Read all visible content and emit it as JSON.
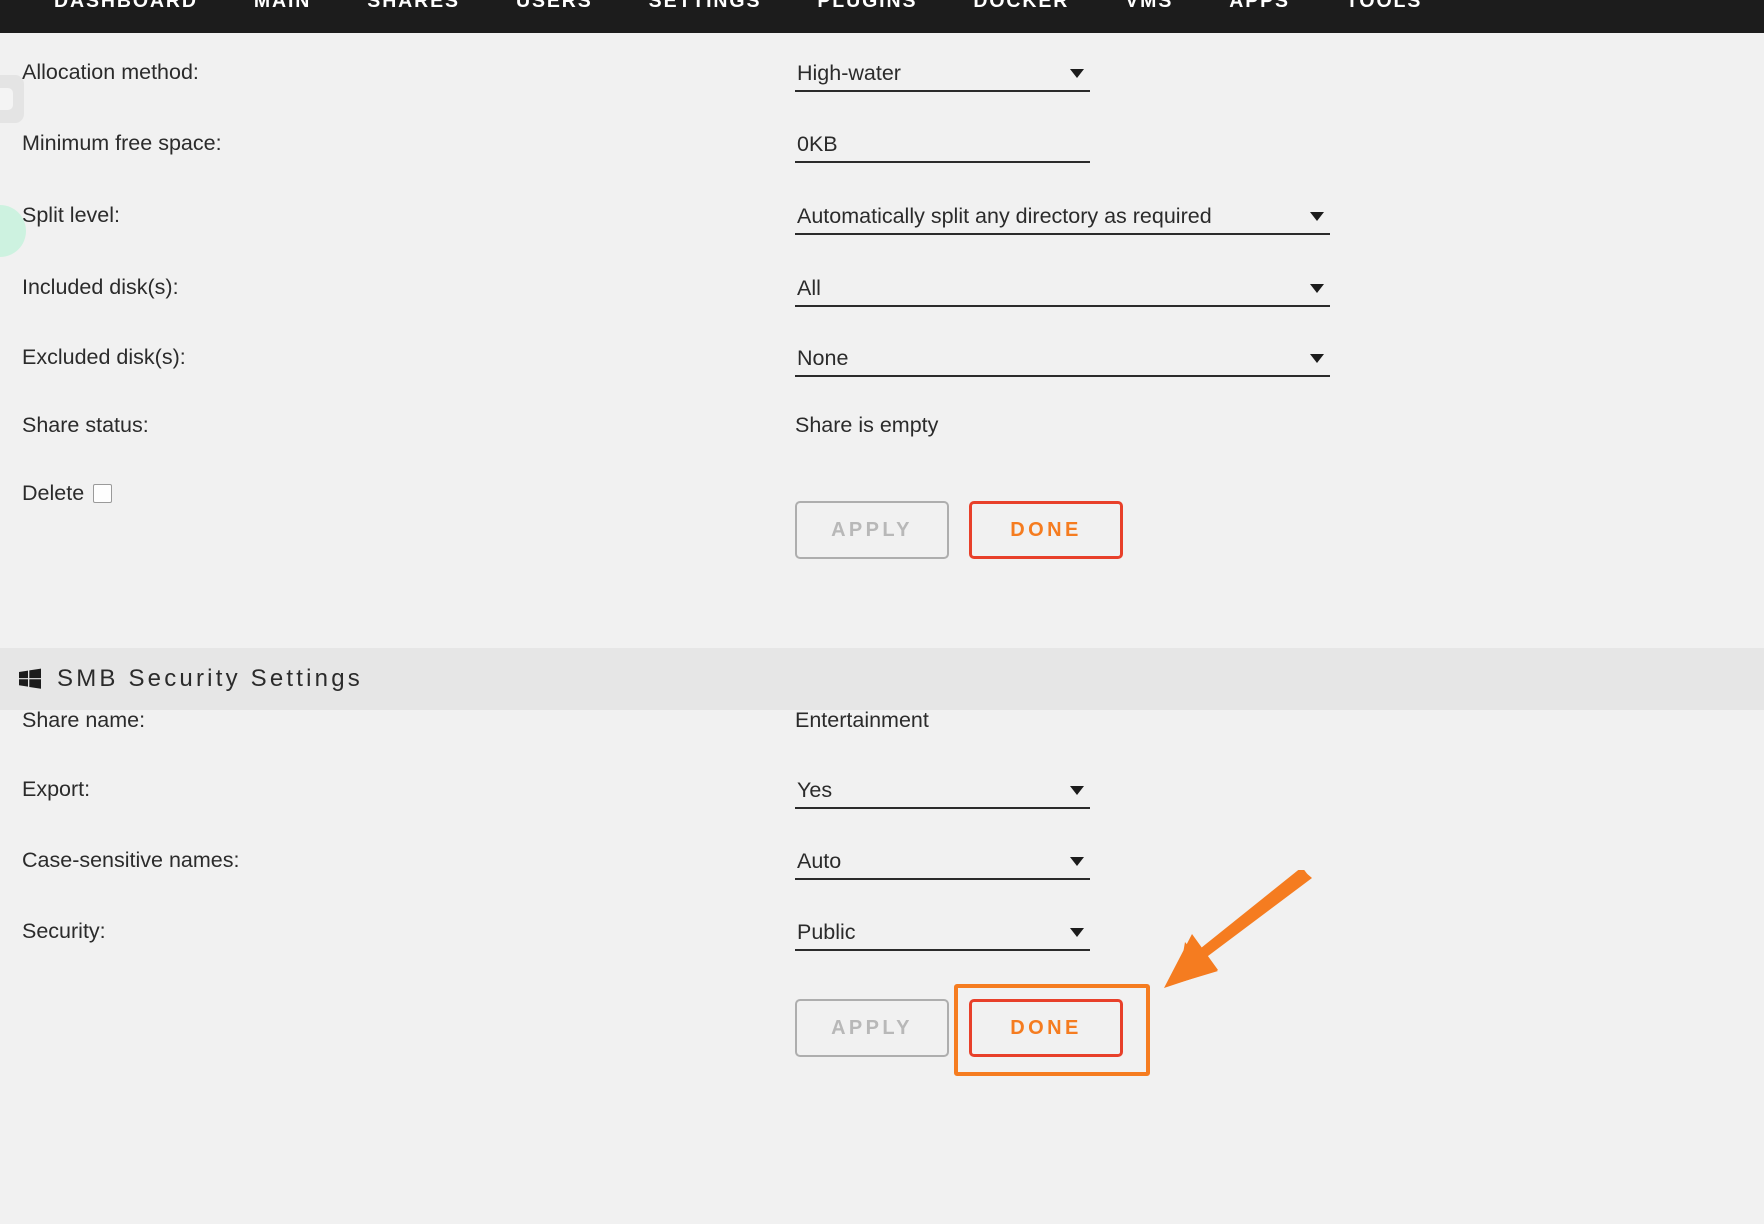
{
  "nav": {
    "items": [
      {
        "label": "DASHBOARD",
        "active": false
      },
      {
        "label": "MAIN",
        "active": false
      },
      {
        "label": "SHARES",
        "active": true
      },
      {
        "label": "USERS",
        "active": false
      },
      {
        "label": "SETTINGS",
        "active": false
      },
      {
        "label": "PLUGINS",
        "active": false
      },
      {
        "label": "DOCKER",
        "active": false
      },
      {
        "label": "VMS",
        "active": false
      },
      {
        "label": "APPS",
        "active": false
      },
      {
        "label": "TOOLS",
        "active": false
      }
    ]
  },
  "share_settings": {
    "allocation_method": {
      "label": "Allocation method:",
      "value": "High-water"
    },
    "minimum_free_space": {
      "label": "Minimum free space:",
      "value": "0KB",
      "placeholder": "0KB"
    },
    "split_level": {
      "label": "Split level:",
      "value": "Automatically split any directory as required"
    },
    "included_disks": {
      "label": "Included disk(s):",
      "value": "All"
    },
    "excluded_disks": {
      "label": "Excluded disk(s):",
      "value": "None"
    },
    "share_status": {
      "label": "Share status:",
      "value": "Share is empty"
    },
    "delete": {
      "label": "Delete",
      "checked": false
    },
    "apply_label": "APPLY",
    "done_label": "DONE"
  },
  "smb_security": {
    "header_title": "SMB Security Settings",
    "header_icon": "windows-icon",
    "share_name": {
      "label": "Share name:",
      "value": "Entertainment"
    },
    "export": {
      "label": "Export:",
      "value": "Yes"
    },
    "case_sensitive_names": {
      "label": "Case-sensitive names:",
      "value": "Auto"
    },
    "security": {
      "label": "Security:",
      "value": "Public"
    },
    "apply_label": "APPLY",
    "done_label": "DONE"
  },
  "colors": {
    "nav_background": "#1c1c1c",
    "page_background": "#f1f1f1",
    "section_band": "#e6e6e6",
    "done_border": "#e8402a",
    "done_text": "#f57c20",
    "apply_border": "#aeaeae",
    "apply_text": "#b8b8b8",
    "annotation": "#f57c20",
    "text": "#2b2b2b"
  },
  "annotation": {
    "highlight_target": "smb-security-done-button",
    "arrow_icon": "arrow-pointing-down-left"
  }
}
